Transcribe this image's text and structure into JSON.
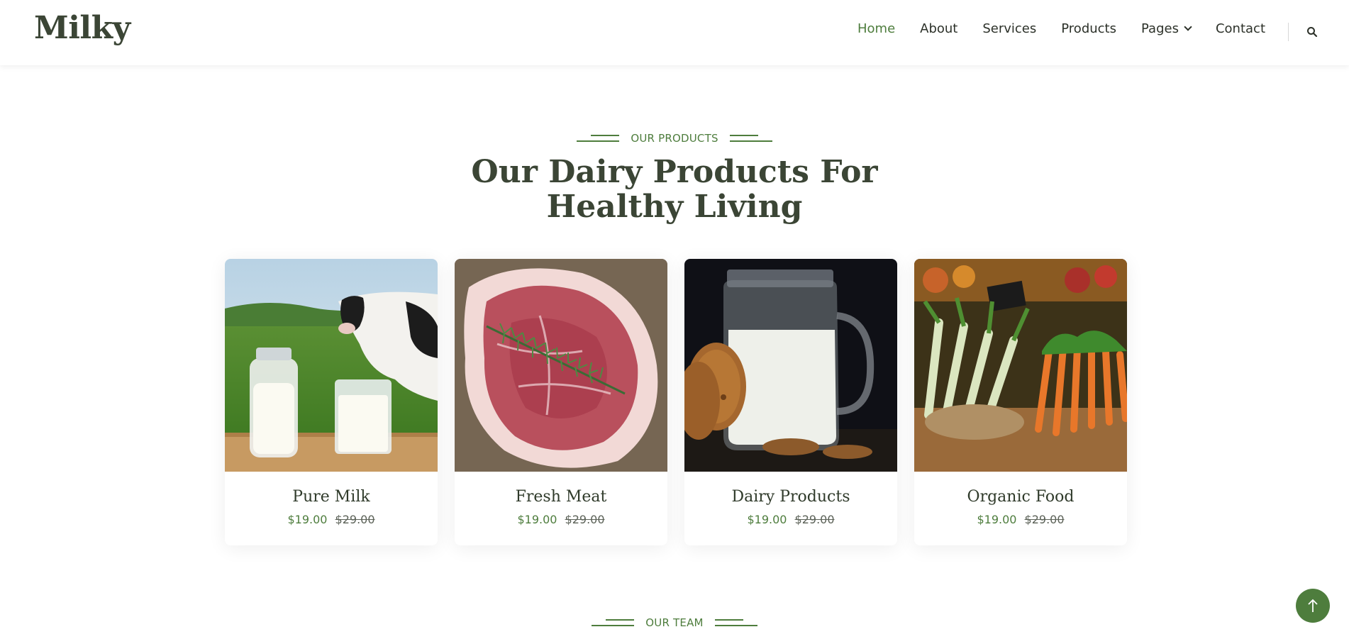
{
  "brand": {
    "logo": "Milky"
  },
  "nav": {
    "items": [
      {
        "label": "Home",
        "active": true
      },
      {
        "label": "About"
      },
      {
        "label": "Services"
      },
      {
        "label": "Products"
      },
      {
        "label": "Pages",
        "dropdown": true
      },
      {
        "label": "Contact"
      }
    ],
    "search_icon": "search-icon"
  },
  "products_section": {
    "eyebrow": "OUR PRODUCTS",
    "title_line1": "Our Dairy Products For",
    "title_line2": "Healthy Living",
    "products": [
      {
        "name": "Pure Milk",
        "price": "$19.00",
        "old_price": "$29.00",
        "image": "milk-bottles-cow-image"
      },
      {
        "name": "Fresh Meat",
        "price": "$19.00",
        "old_price": "$29.00",
        "image": "raw-steak-image"
      },
      {
        "name": "Dairy Products",
        "price": "$19.00",
        "old_price": "$29.00",
        "image": "milk-jar-cookies-image"
      },
      {
        "name": "Organic Food",
        "price": "$19.00",
        "old_price": "$29.00",
        "image": "vegetables-market-image"
      }
    ]
  },
  "team_section": {
    "eyebrow": "OUR TEAM"
  },
  "colors": {
    "accent": "#4e7d3d",
    "heading": "#3b4535"
  },
  "back_to_top_icon": "arrow-up-icon"
}
